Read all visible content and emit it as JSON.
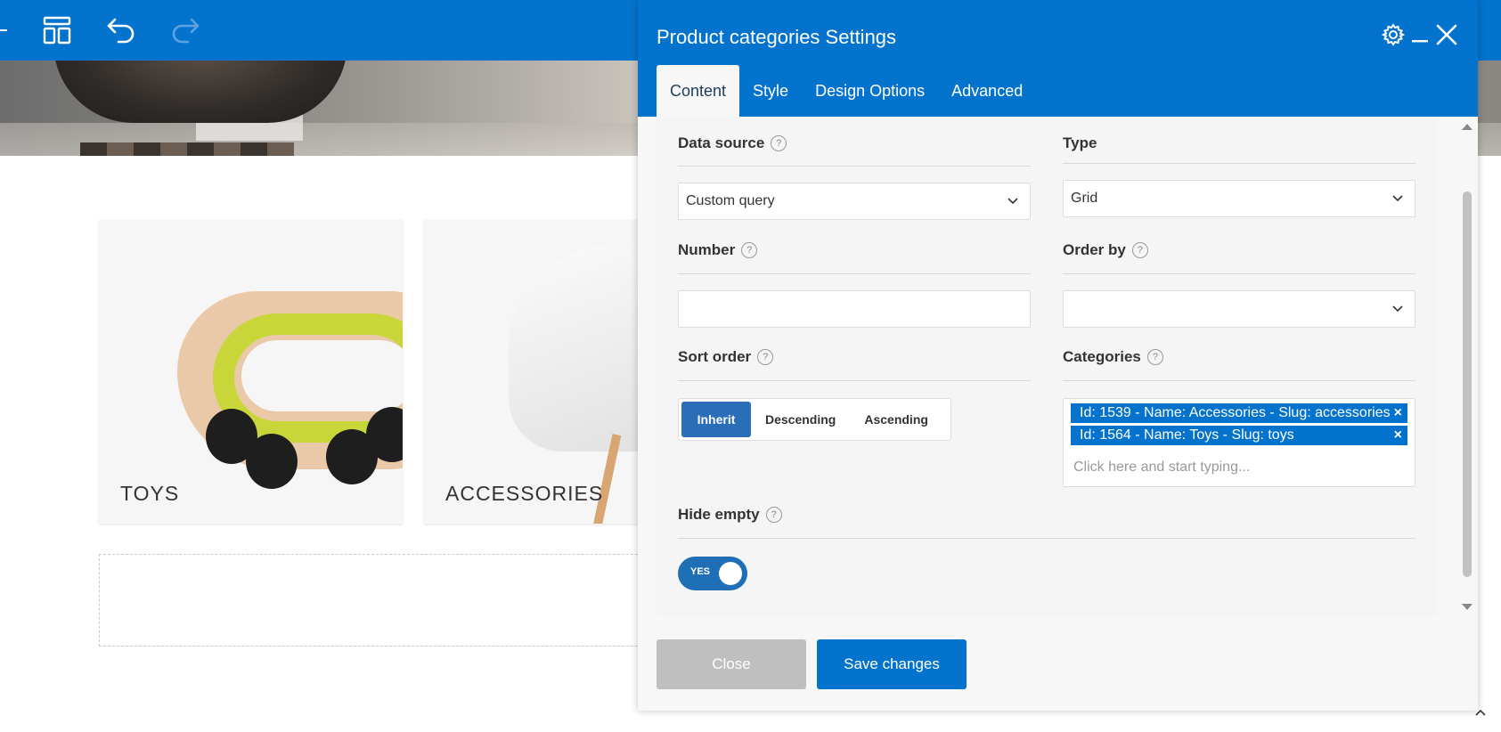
{
  "editor": {
    "toolbar_icons": [
      "layout-icon",
      "undo-icon",
      "redo-icon"
    ]
  },
  "cards": [
    {
      "label": "TOYS"
    },
    {
      "label": "ACCESSORIES"
    }
  ],
  "panel": {
    "title": "Product categories Settings",
    "tabs": [
      {
        "label": "Content",
        "active": true
      },
      {
        "label": "Style"
      },
      {
        "label": "Design Options"
      },
      {
        "label": "Advanced"
      }
    ],
    "fields": {
      "data_source": {
        "label": "Data source",
        "help": "?",
        "value": "Custom query"
      },
      "type": {
        "label": "Type",
        "value": "Grid"
      },
      "number": {
        "label": "Number",
        "help": "?",
        "value": ""
      },
      "order_by": {
        "label": "Order by",
        "help": "?",
        "value": ""
      },
      "sort_order": {
        "label": "Sort order",
        "help": "?",
        "options": [
          "Inherit",
          "Descending",
          "Ascending"
        ],
        "selected": "Inherit"
      },
      "categories": {
        "label": "Categories",
        "help": "?",
        "chips": [
          "Id: 1539 - Name: Accessories - Slug: accessories",
          "Id: 1564 - Name: Toys - Slug: toys"
        ],
        "remove": "×",
        "placeholder": "Click here and start typing..."
      },
      "hide_empty": {
        "label": "Hide empty",
        "help": "?",
        "toggle_text": "YES",
        "on": true
      }
    },
    "buttons": {
      "close": "Close",
      "save": "Save changes"
    }
  },
  "colors": {
    "primary": "#0473cd",
    "panel_bg": "#f7f7f7",
    "close_btn": "#bfbfbf"
  }
}
